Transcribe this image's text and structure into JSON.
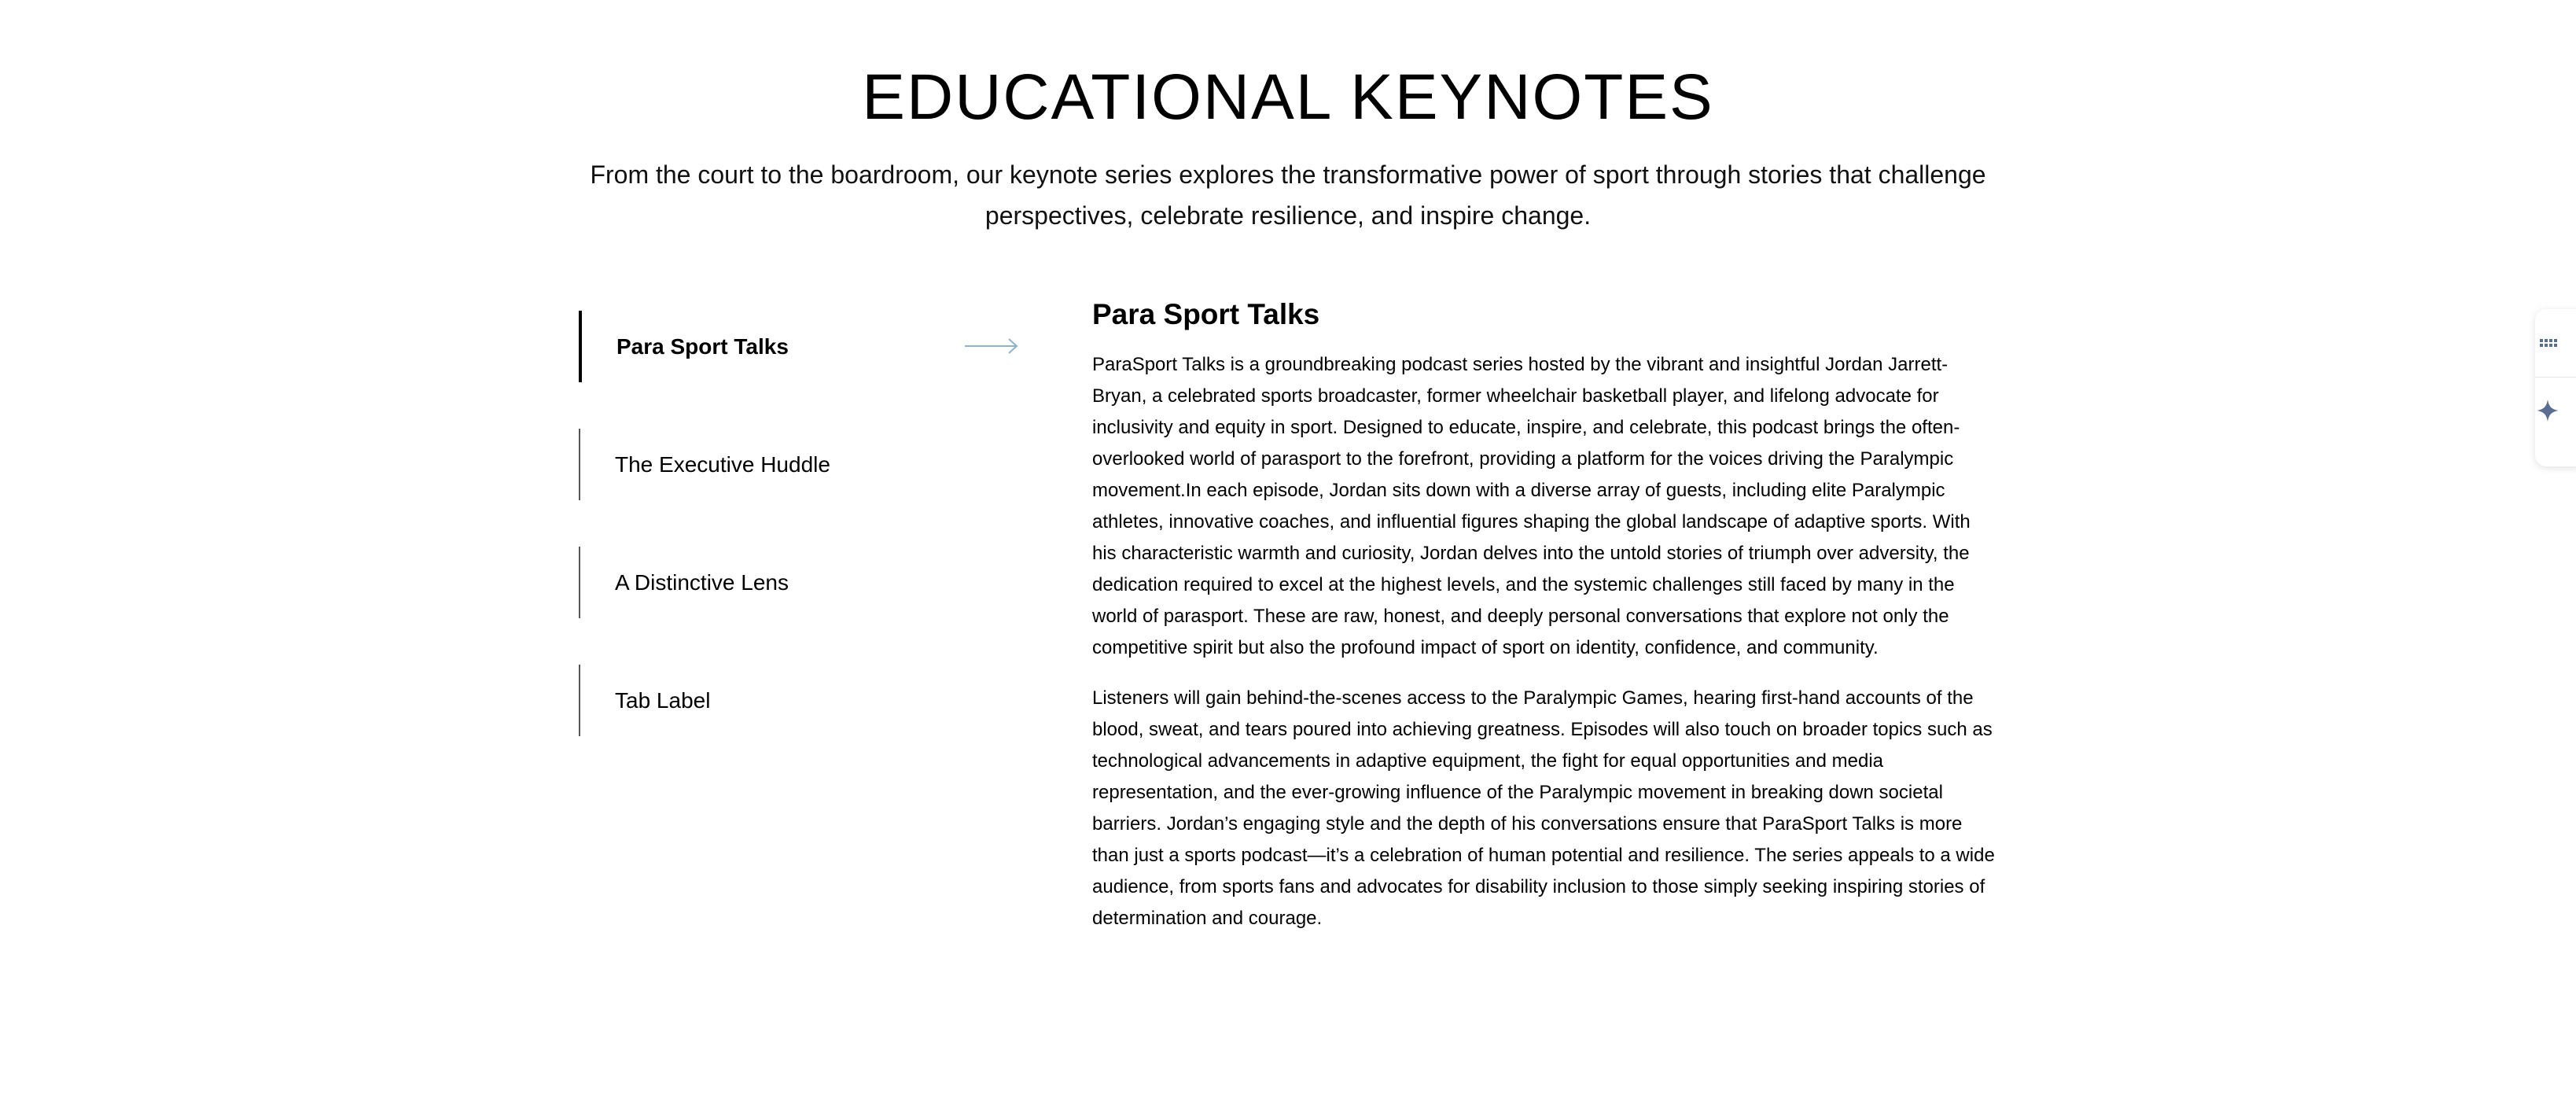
{
  "header": {
    "title": "EDUCATIONAL KEYNOTES",
    "subtitle": "From the court to the boardroom, our keynote series explores the transformative power of sport through stories that challenge perspectives, celebrate resilience, and inspire change."
  },
  "tabs": [
    {
      "label": "Para Sport Talks",
      "active": true
    },
    {
      "label": "The Executive Huddle",
      "active": false
    },
    {
      "label": "A Distinctive Lens",
      "active": false
    },
    {
      "label": "Tab Label",
      "active": false
    }
  ],
  "content": {
    "title": "Para Sport Talks",
    "paragraphs": [
      "ParaSport Talks is a groundbreaking podcast series hosted by the vibrant and insightful Jordan Jarrett-Bryan, a celebrated sports broadcaster, former wheelchair basketball player, and lifelong advocate for inclusivity and equity in sport. Designed to educate, inspire, and celebrate, this podcast brings the often-overlooked world of parasport to the forefront, providing a platform for the voices driving the Paralympic movement.In each episode, Jordan sits down with a diverse array of guests, including elite Paralympic athletes, innovative coaches, and influential figures shaping the global landscape of adaptive sports. With his characteristic warmth and curiosity, Jordan delves into the untold stories of triumph over adversity, the dedication required to excel at the highest levels, and the systemic challenges still faced by many in the world of parasport. These are raw, honest, and deeply personal conversations that explore not only the competitive spirit but also the profound impact of sport on identity, confidence, and community.",
      "Listeners will gain behind-the-scenes access to the Paralympic Games, hearing first-hand accounts of the blood, sweat, and tears poured into achieving greatness. Episodes will also touch on broader topics such as technological advancements in adaptive equipment, the fight for equal opportunities and media representation, and the ever-growing influence of the Paralympic movement in breaking down societal barriers. Jordan’s engaging style and the depth of his conversations ensure that ParaSport Talks is more than just a sports podcast—it’s a celebration of human potential and resilience. The series appeals to a wide audience, from sports fans and advocates for disability inclusion to those simply seeking inspiring stories of determination and courage."
    ]
  },
  "icons": {
    "active_tab_arrow": "long-right-arrow-icon",
    "side_top": "grid-dots-icon",
    "side_bottom": "sparkle-icon"
  },
  "colors": {
    "arrow": "#8fb3c7",
    "side_icon": "#5a6f8f",
    "active_border": "#000000",
    "inactive_border": "#555555"
  }
}
